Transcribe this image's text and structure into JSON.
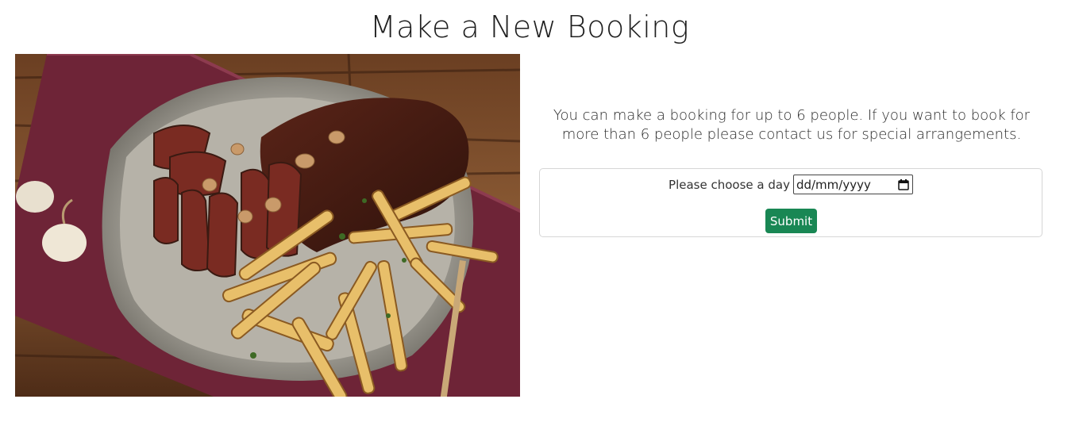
{
  "page": {
    "title": "Make a New Booking"
  },
  "hero": {
    "alt": "Sliced steak with fries on a metal plate"
  },
  "booking": {
    "info_text": "You can make a booking for up to 6 people. If you want to book for more than 6 people please contact us for special arrangements.",
    "date_label": "Please choose a day",
    "date_placeholder": "dd/mm/yyyy",
    "submit_label": "Submit"
  },
  "colors": {
    "submit_bg": "#198754"
  }
}
